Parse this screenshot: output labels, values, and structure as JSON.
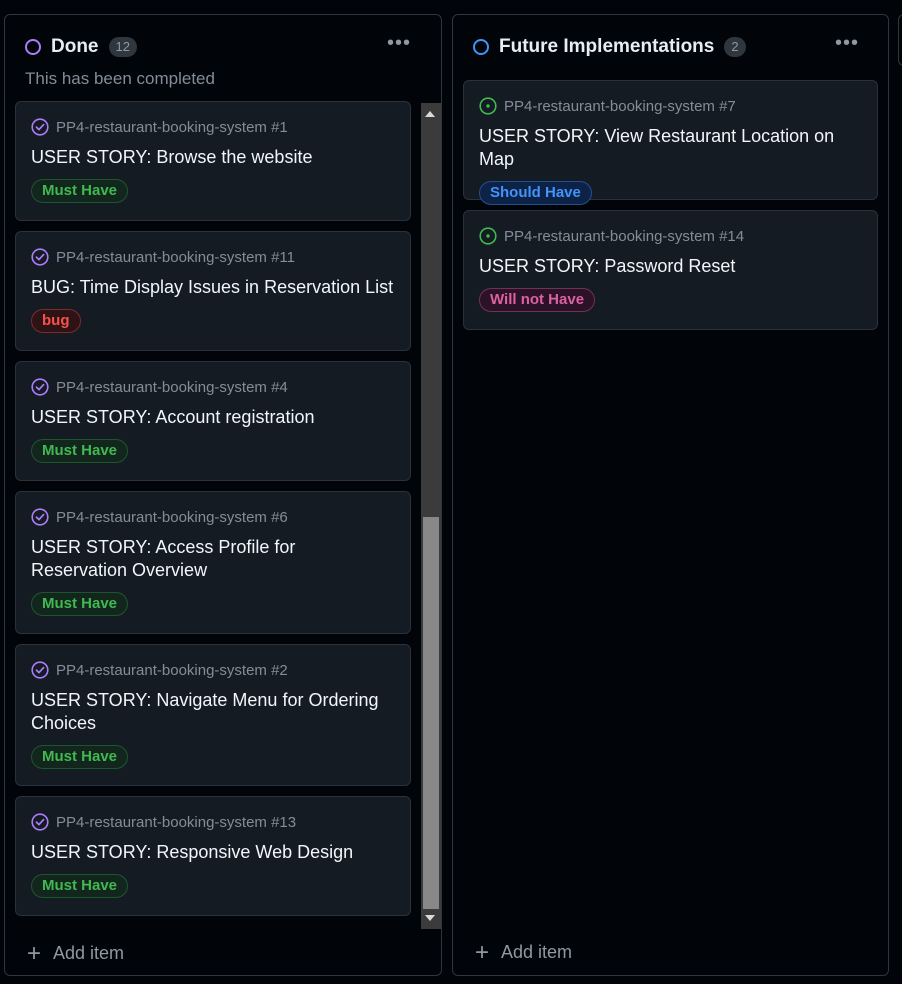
{
  "columns": {
    "done": {
      "title": "Done",
      "count": "12",
      "description": "This has been completed",
      "status_color": "#ab7df8",
      "add_item": "Add item",
      "cards": [
        {
          "ref": "PP4-restaurant-booking-system #1",
          "title": "USER STORY: Browse the website",
          "label": "Must Have",
          "icon": "issue-closed-icon"
        },
        {
          "ref": "PP4-restaurant-booking-system #11",
          "title": "BUG: Time Display Issues in Reservation List",
          "label": "bug",
          "icon": "issue-closed-icon"
        },
        {
          "ref": "PP4-restaurant-booking-system #4",
          "title": "USER STORY: Account registration",
          "label": "Must Have",
          "icon": "issue-closed-icon"
        },
        {
          "ref": "PP4-restaurant-booking-system #6",
          "title": "USER STORY: Access Profile for Reservation Overview",
          "label": "Must Have",
          "icon": "issue-closed-icon"
        },
        {
          "ref": "PP4-restaurant-booking-system #2",
          "title": "USER STORY: Navigate Menu for Ordering Choices",
          "label": "Must Have",
          "icon": "issue-closed-icon"
        },
        {
          "ref": "PP4-restaurant-booking-system #13",
          "title": "USER STORY: Responsive Web Design",
          "label": "Must Have",
          "icon": "issue-closed-icon"
        }
      ]
    },
    "future": {
      "title": "Future Implementations",
      "count": "2",
      "status_color": "#4493f8",
      "add_item": "Add item",
      "cards": [
        {
          "ref": "PP4-restaurant-booking-system #7",
          "title": "USER STORY: View Restaurant Location on Map",
          "label": "Should Have",
          "icon": "issue-open-icon"
        },
        {
          "ref": "PP4-restaurant-booking-system #14",
          "title": "USER STORY: Password Reset",
          "label": "Will not Have",
          "icon": "issue-open-icon"
        }
      ]
    }
  },
  "colors": {
    "closed_purple": "#ab7df8",
    "open_green": "#3fb950",
    "must_have": "#3fb950",
    "bug": "#f85149",
    "should_have": "#4493f8",
    "will_not_have": "#db61a2"
  }
}
